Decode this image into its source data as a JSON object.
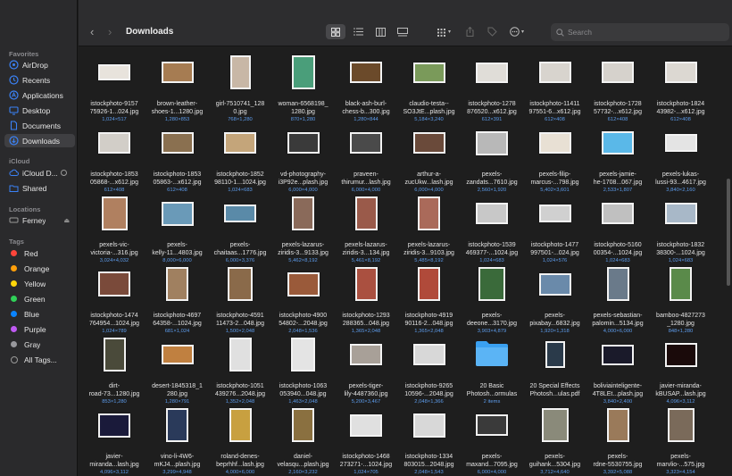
{
  "window": {
    "title": "Downloads"
  },
  "colors": {
    "accent": "#3b82f6",
    "size_text": "#5d9cec"
  },
  "sidebar": {
    "sections": [
      {
        "heading": "Favorites",
        "items": [
          {
            "label": "AirDrop",
            "icon": "airdrop-icon"
          },
          {
            "label": "Recents",
            "icon": "clock-icon"
          },
          {
            "label": "Applications",
            "icon": "applications-icon"
          },
          {
            "label": "Desktop",
            "icon": "desktop-icon"
          },
          {
            "label": "Documents",
            "icon": "document-icon"
          },
          {
            "label": "Downloads",
            "icon": "download-icon",
            "active": true
          }
        ]
      },
      {
        "heading": "iCloud",
        "items": [
          {
            "label": "iCloud D...",
            "icon": "cloud-icon"
          },
          {
            "label": "Shared",
            "icon": "shared-folder-icon"
          }
        ]
      },
      {
        "heading": "Locations",
        "items": [
          {
            "label": "Ferney",
            "icon": "disk-icon"
          }
        ]
      },
      {
        "heading": "Tags",
        "items": [
          {
            "label": "Red",
            "color": "#ff453a"
          },
          {
            "label": "Orange",
            "color": "#ff9f0a"
          },
          {
            "label": "Yellow",
            "color": "#ffd60a"
          },
          {
            "label": "Green",
            "color": "#30d158"
          },
          {
            "label": "Blue",
            "color": "#0a84ff"
          },
          {
            "label": "Purple",
            "color": "#bf5af2"
          },
          {
            "label": "Gray",
            "color": "#98989d"
          },
          {
            "label": "All Tags...",
            "icon": "all-tags-icon"
          }
        ]
      }
    ]
  },
  "search": {
    "placeholder": "Search"
  },
  "files": [
    {
      "name": "istockphoto-9157\n75926-1...024.jpg",
      "size": "1,024×517",
      "color": "#e8e3dc"
    },
    {
      "name": "brown-leather-\nshoes-1...1280.jpg",
      "size": "1,280×853",
      "color": "#a67c52"
    },
    {
      "name": "girl-7510741_128\n0.jpg",
      "size": "768×1,280",
      "color": "#c8b7a6"
    },
    {
      "name": "woman-6568198_\n1280.jpg",
      "size": "870×1,280",
      "color": "#4a9e7a"
    },
    {
      "name": "black-ash-burl-\nchess-b...300.jpg",
      "size": "1,280×844",
      "color": "#6b4a2a"
    },
    {
      "name": "claudio-testa--\nSO3JtE...plash.jpg",
      "size": "5,184×3,240",
      "color": "#7a9a5a"
    },
    {
      "name": "istockphoto-1278\n876520...x612.jpg",
      "size": "612×391",
      "color": "#e0ddd8"
    },
    {
      "name": "istockphoto-11411\n97551-6...x612.jpg",
      "size": "612×408",
      "color": "#d8d4ce"
    },
    {
      "name": "istockphoto-1728\n57732-...x612.jpg",
      "size": "612×408",
      "color": "#d6d2cc"
    },
    {
      "name": "istockphoto-1824\n43982-...x612.jpg",
      "size": "612×408",
      "color": "#dcd8d2"
    },
    {
      "name": "istockphoto-1853\n05868-...x612.jpg",
      "size": "612×408",
      "color": "#d2cec8"
    },
    {
      "name": "istockphoto-1853\n05863-...x612.jpg",
      "size": "612×408",
      "color": "#8a7050"
    },
    {
      "name": "istockphoto-1852\n98110-1...1024.jpg",
      "size": "1,024×683",
      "color": "#c4a57a"
    },
    {
      "name": "vd-photography-\ni3P92e...plash.jpg",
      "size": "6,000×4,000",
      "color": "#3a3a3a"
    },
    {
      "name": "praveen-\nthirumur...lash.jpg",
      "size": "6,000×4,000",
      "color": "#4a4a4a"
    },
    {
      "name": "arthur-a-\nzucUkw...lash.jpg",
      "size": "6,000×4,000",
      "color": "#6a4a3a"
    },
    {
      "name": "pexels-\nzandats...7610.jpg",
      "size": "2,560×1,920",
      "color": "#b8b8b8"
    },
    {
      "name": "pexels-filip-\nmarcus-...798.jpg",
      "size": "5,402×3,601",
      "color": "#e8e0d4"
    },
    {
      "name": "pexels-jamie-\nhe-1708...067.jpg",
      "size": "2,533×1,807",
      "color": "#5ab8e8"
    },
    {
      "name": "pexels-lukas-\nlussi-93...4617.jpg",
      "size": "3,840×2,160",
      "color": "#e4e4e4"
    },
    {
      "name": "pexels-vic-\nvictoria-...316.jpg",
      "size": "3,024×4,032",
      "color": "#b08060"
    },
    {
      "name": "pexels-\nkelly-11...4803.jpg",
      "size": "8,000×6,000",
      "color": "#6a9ab8"
    },
    {
      "name": "pexels-\nchaitaas...1776.jpg",
      "size": "6,000×3,376",
      "color": "#5a8aa8"
    },
    {
      "name": "pexels-lazarus-\nziridis-3...9133.jpg",
      "size": "5,462×8,192",
      "color": "#8a6a5a"
    },
    {
      "name": "pexels-lazarus-\nziridis-3...134.jpg",
      "size": "5,461×8,192",
      "color": "#9a5a4a"
    },
    {
      "name": "pexels-lazarus-\nziridis-3...9103.jpg",
      "size": "5,485×8,192",
      "color": "#aa6a5a"
    },
    {
      "name": "istockphoto-1539\n469377-...1024.jpg",
      "size": "1,024×683",
      "color": "#c8c8c8"
    },
    {
      "name": "istockphoto-1477\n997501-...024.jpg",
      "size": "1,024×576",
      "color": "#d0d0d0"
    },
    {
      "name": "istockphoto-5160\n00354-...1024.jpg",
      "size": "1,024×683",
      "color": "#c0c0c0"
    },
    {
      "name": "istockphoto-1832\n38300-...1024.jpg",
      "size": "1,024×683",
      "color": "#a8b8c8"
    },
    {
      "name": "istockphoto-1474\n764954...1024.jpg",
      "size": "1,024×789",
      "color": "#7a4a3a"
    },
    {
      "name": "istockphoto-4697\n64358-...1024.jpg",
      "size": "681×1,024",
      "color": "#a08060"
    },
    {
      "name": "istockphoto-4591\n11473-2...048.jpg",
      "size": "1,500×2,048",
      "color": "#8a6a4a"
    },
    {
      "name": "istockphoto-4900\n54802-...2048.jpg",
      "size": "2,048×1,536",
      "color": "#9a5a3a"
    },
    {
      "name": "istockphoto-1293\n288365...048.jpg",
      "size": "1,365×2,048",
      "color": "#aa5040"
    },
    {
      "name": "istockphoto-4919\n90116-2...048.jpg",
      "size": "1,365×2,048",
      "color": "#b04a3a"
    },
    {
      "name": "pexels-\ndeeone...3170.jpg",
      "size": "3,903×4,879",
      "color": "#3a6a3a"
    },
    {
      "name": "pexels-\npixabay...6832.jpg",
      "size": "1,920×1,318",
      "color": "#6a8aaa"
    },
    {
      "name": "pexels-sebastian-\npalomin...5134.jpg",
      "size": "4,000×6,000",
      "color": "#6a7a8a"
    },
    {
      "name": "bamboo-4827273\n_1280.jpg",
      "size": "848×1,280",
      "color": "#5a8a4a"
    },
    {
      "name": "dirt-\nroad-73...1280.jpg",
      "size": "853×1,280",
      "color": "#4a4a3a"
    },
    {
      "name": "desert-1845318_1\n280.jpg",
      "size": "1,280×791",
      "color": "#c08040"
    },
    {
      "name": "istockphoto-1051\n439276...2048.jpg",
      "size": "1,352×2,048",
      "color": "#e0e0e0"
    },
    {
      "name": "istockphoto-1063\n053940...048.jpg",
      "size": "1,463×2,048",
      "color": "#e4e4e4"
    },
    {
      "name": "pexels-tiger-\nlily-4487360.jpg",
      "size": "5,200×3,467",
      "color": "#a8a098"
    },
    {
      "name": "istockphoto-9265\n10596-...2048.jpg",
      "size": "2,048×1,366",
      "color": "#d8d8d8"
    },
    {
      "name": "20 Basic\nPhotosh...ormulas",
      "size": "2 items",
      "color": "#3aa0f0",
      "folder": true
    },
    {
      "name": "20 Special Effects\nPhotosh...ulas.pdf",
      "size": "",
      "color": "#2a3a4a"
    },
    {
      "name": "boliviainteligente-\n4T8LEt...plash.jpg",
      "size": "3,840×2,400",
      "color": "#1a1a2a"
    },
    {
      "name": "javier-miranda-\nkBUSAP...lash.jpg",
      "size": "4,096×3,112",
      "color": "#1a0a0a"
    },
    {
      "name": "javier-\nmiranda...lash.jpg",
      "size": "4,096×3,112",
      "color": "#1a1a3a"
    },
    {
      "name": "vino-li-4W6-\nmKJ4...plash.jpg",
      "size": "3,299×4,948",
      "color": "#2a3a5a"
    },
    {
      "name": "roland-denes-\nbeprhhf...lash.jpg",
      "size": "4,000×6,000",
      "color": "#c8a040"
    },
    {
      "name": "daniel-\nvelasqu...plash.jpg",
      "size": "2,160×3,232",
      "color": "#8a7040"
    },
    {
      "name": "istockphoto-1468\n273271-...1024.jpg",
      "size": "1,024×705",
      "color": "#e0e0e0"
    },
    {
      "name": "istockphoto-1334\n803015...2048.jpg",
      "size": "2,048×1,543",
      "color": "#d8d8d8"
    },
    {
      "name": "pexels-\nmaxand...7095.jpg",
      "size": "6,000×4,000",
      "color": "#3a3a3a"
    },
    {
      "name": "pexels-\nguihank...5304.jpg",
      "size": "3,712×4,640",
      "color": "#8a8a7a"
    },
    {
      "name": "pexels-\nrdne-5530755.jpg",
      "size": "3,392×5,088",
      "color": "#9a7a5a"
    },
    {
      "name": "pexels-\nmarvlio-...575.jpg",
      "size": "3,323×4,154",
      "color": "#7a6a5a"
    }
  ]
}
